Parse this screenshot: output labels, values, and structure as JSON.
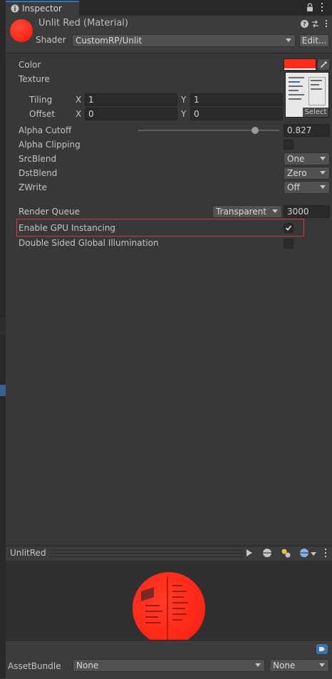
{
  "tab": {
    "title": "Inspector"
  },
  "header": {
    "material_name": "Unlit Red (Material)",
    "shader_label": "Shader",
    "shader_value": "CustomRP/Unlit",
    "edit_label": "Edit..."
  },
  "props": {
    "color_label": "Color",
    "texture_label": "Texture",
    "tiling_label": "Tiling",
    "offset_label": "Offset",
    "x_label": "X",
    "y_label": "Y",
    "tiling_x": "1",
    "tiling_y": "1",
    "offset_x": "0",
    "offset_y": "0",
    "select_label": "Select",
    "alpha_cutoff_label": "Alpha Cutoff",
    "alpha_cutoff_value": "0.827",
    "alpha_cutoff_fraction": 0.827,
    "alpha_clipping_label": "Alpha Clipping",
    "srcblend_label": "SrcBlend",
    "srcblend_value": "One",
    "dstblend_label": "DstBlend",
    "dstblend_value": "Zero",
    "zwrite_label": "ZWrite",
    "zwrite_value": "Off"
  },
  "queue": {
    "label": "Render Queue",
    "mode": "Transparent",
    "value": "3000"
  },
  "gpu_instancing": {
    "label": "Enable GPU Instancing",
    "checked": true
  },
  "double_sided_gi": {
    "label": "Double Sided Global Illumination",
    "checked": false
  },
  "preview": {
    "title": "UnlitRed"
  },
  "assetbundle": {
    "label": "AssetBundle",
    "name_value": "None",
    "variant_value": "None"
  },
  "colors": {
    "material_color": "#ff2a1a",
    "highlight_outline": "#d23a3a",
    "accent": "#3a72b0"
  }
}
